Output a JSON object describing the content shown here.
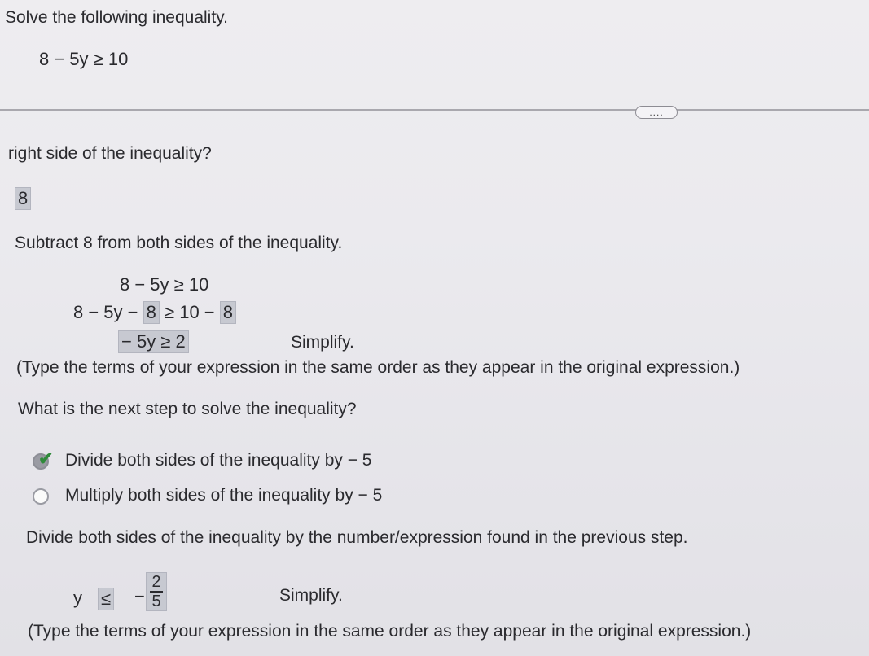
{
  "header": {
    "instruction": "Solve the following inequality.",
    "inequality": "8 − 5y ≥ 10"
  },
  "more_button": "....",
  "step1": {
    "question_fragment": "right side of the inequality?",
    "answer": "8"
  },
  "step2": {
    "instruction": "Subtract 8 from both sides of the inequality.",
    "line1": "8 − 5y ≥ 10",
    "line2_left": "8 − 5y −",
    "line2_box1": "8",
    "line2_mid": "≥ 10 −",
    "line2_box2": "8",
    "simplified": "− 5y ≥ 2",
    "simplify_label": "Simplify.",
    "note": "(Type the terms of your expression in the same order as they appear in the original expression.)"
  },
  "step3": {
    "question": "What is the next step to solve the inequality?",
    "options": [
      {
        "label": "Divide both sides of the inequality by  − 5",
        "selected": true
      },
      {
        "label": "Multiply both sides of the inequality by  − 5",
        "selected": false
      }
    ]
  },
  "step4": {
    "instruction": "Divide both sides of the inequality by the number/expression found in the previous step.",
    "var": "y",
    "relation": "≤",
    "sign": "−",
    "numerator": "2",
    "denominator": "5",
    "simplify_label": "Simplify.",
    "note": "(Type the terms of your expression in the same order as they appear in the original expression.)"
  },
  "colors": {
    "background": "#ebeaee",
    "answer_box": "#c7c9d1",
    "check": "#2f8a3a"
  }
}
